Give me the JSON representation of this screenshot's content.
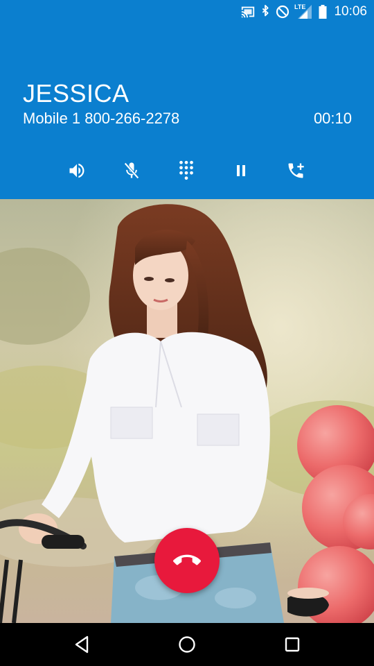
{
  "status_bar": {
    "time": "10:06",
    "network_label": "LTE",
    "icons": [
      "cast-icon",
      "bluetooth-icon",
      "do-not-disturb-icon",
      "lte-signal-icon",
      "battery-icon"
    ]
  },
  "call": {
    "contact_name": "JESSICA",
    "number_line": "Mobile 1 800-266-2278",
    "duration": "00:10"
  },
  "controls": [
    "speaker-icon",
    "mute-icon",
    "dialpad-icon",
    "hold-icon",
    "add-call-icon"
  ],
  "nav": [
    "back-icon",
    "home-icon",
    "recents-icon"
  ],
  "colors": {
    "header_blue": "#0b7fcf",
    "end_call_red": "#e8193c",
    "nav_black": "#000000"
  }
}
